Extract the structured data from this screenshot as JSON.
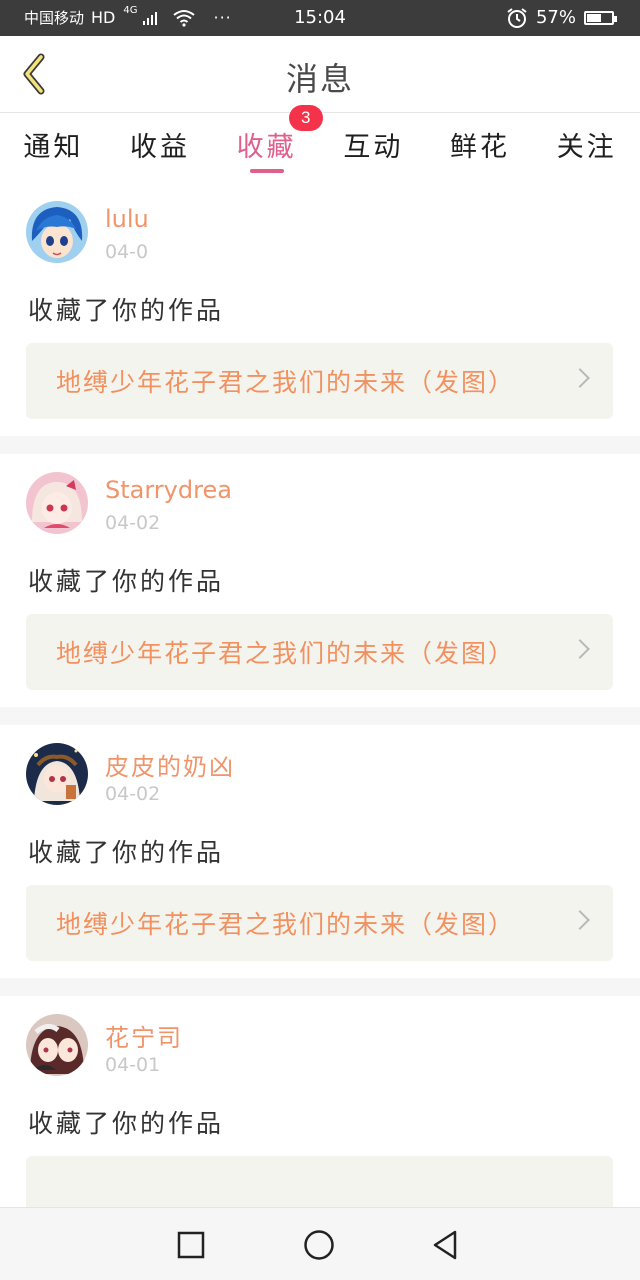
{
  "status_bar": {
    "carrier": "中国移动",
    "hd": "HD",
    "network": "4G",
    "dots": "···",
    "time": "15:04",
    "battery_percent": "57%",
    "battery_level": 0.57
  },
  "header": {
    "title": "消息",
    "back_icon": "chevron-left-icon"
  },
  "tabs": [
    {
      "label": "通知",
      "active": false
    },
    {
      "label": "收益",
      "active": false
    },
    {
      "label": "收藏",
      "active": true,
      "badge": "3"
    },
    {
      "label": "互动",
      "active": false
    },
    {
      "label": "鲜花",
      "active": false
    },
    {
      "label": "关注",
      "active": false
    }
  ],
  "feed": [
    {
      "username": "lulu",
      "date": "04-0",
      "action": "收藏了你的作品",
      "work_title": "地缚少年花子君之我们的未来（发图）"
    },
    {
      "username": "Starrydrea",
      "date": "04-02",
      "action": "收藏了你的作品",
      "work_title": "地缚少年花子君之我们的未来（发图）"
    },
    {
      "username": "皮皮的奶凶",
      "date": "04-02",
      "action": "收藏了你的作品",
      "work_title": "地缚少年花子君之我们的未来（发图）"
    },
    {
      "username": "花宁司",
      "date": "04-01",
      "action": "收藏了你的作品",
      "work_title": ""
    }
  ],
  "colors": {
    "accent": "#e05f8c",
    "username": "#f0946a",
    "work_title": "#f2915f",
    "badge": "#f4334a",
    "status_bar_bg": "#3c3c3c"
  }
}
